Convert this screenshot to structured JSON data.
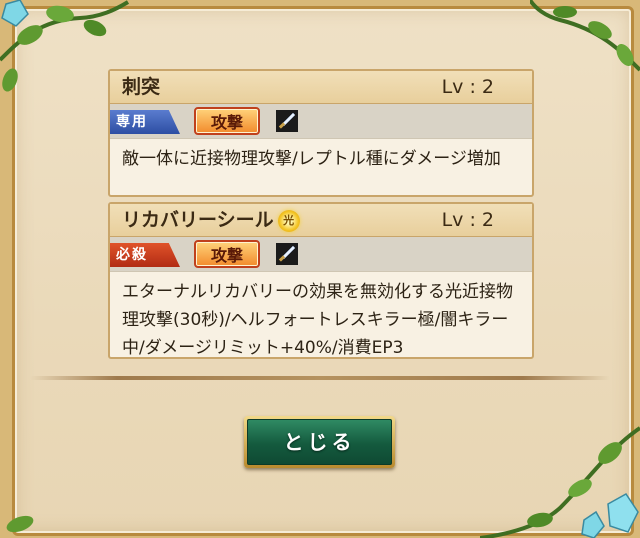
{
  "skills": [
    {
      "name": "刺突",
      "level_label": "Lv : 2",
      "kind_label": "専用",
      "kind_color": "#2d4ea3",
      "type_label": "攻撃",
      "weapon_icon": "sword-icon",
      "element": null,
      "description": "敵一体に近接物理攻撃/レプトル種にダメージ増加"
    },
    {
      "name": "リカバリーシール",
      "level_label": "Lv : 2",
      "kind_label": "必殺",
      "kind_color": "#b12b14",
      "type_label": "攻撃",
      "weapon_icon": "sword-icon",
      "element": "光",
      "description": "エターナルリカバリーの効果を無効化する光近接物理攻撃(30秒)/ヘルフォートレスキラー極/闇キラー中/ダメージリミット+40%/消費EP3"
    }
  ],
  "close_button_label": "とじる",
  "colors": {
    "panel_bg": "#ead9b9",
    "frame": "#b88a3e",
    "button_green": "#145a3e",
    "button_gold": "#b98a2d"
  }
}
